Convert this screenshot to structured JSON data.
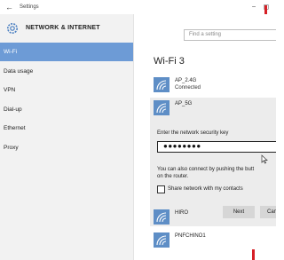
{
  "window": {
    "title": "Settings",
    "back_icon": "arrow-left-icon",
    "controls": [
      "−",
      "◻"
    ]
  },
  "sidebar": {
    "title": "NETWORK & INTERNET",
    "icon": "gear-icon",
    "items": [
      {
        "label": "Wi-Fi",
        "active": true
      },
      {
        "label": "Data usage",
        "active": false
      },
      {
        "label": "VPN",
        "active": false
      },
      {
        "label": "Dial-up",
        "active": false
      },
      {
        "label": "Ethernet",
        "active": false
      },
      {
        "label": "Proxy",
        "active": false
      }
    ]
  },
  "search": {
    "placeholder": "Find a setting"
  },
  "main": {
    "page_title": "Wi-Fi 3",
    "networks": [
      {
        "name": "AP_2.4G",
        "status": "Connected"
      },
      {
        "name": "AP_5G",
        "status": ""
      },
      {
        "name": "HIRO",
        "status": ""
      },
      {
        "name": "PNFCHINO1",
        "status": ""
      }
    ],
    "security_prompt": "Enter the network security key",
    "key_value": "●●●●●●●●",
    "info_line1": "You can also connect by pushing the butt",
    "info_line2": "on the router.",
    "share_label": "Share network with my contacts",
    "next_label": "Next",
    "cancel_label": "Cance"
  },
  "colors": {
    "accent": "#6d9bd6",
    "tile": "#5e8ec6",
    "red_marker": "#d61f26"
  }
}
